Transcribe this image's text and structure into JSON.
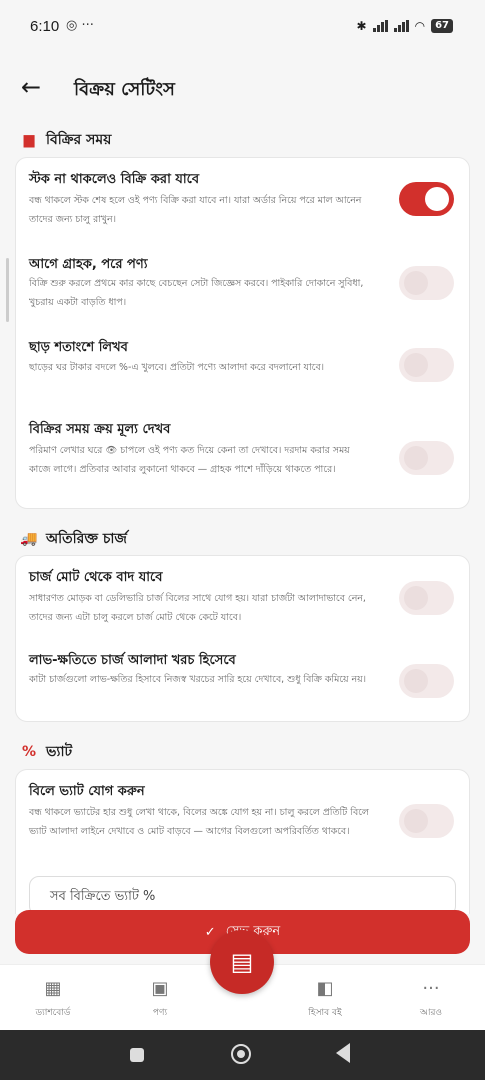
{
  "status": {
    "time": "6:10",
    "left_icons": "◎ ···",
    "battery": "67"
  },
  "appbar": {
    "back_glyph": "←",
    "title": "বিক্রয় সেটিংস"
  },
  "sections": {
    "sales": {
      "icon": "cash-register-icon",
      "icon_glyph": "▆",
      "title": "বিক্রির সময়",
      "rows": [
        {
          "title": "স্টক না থাকলেও বিক্রি করা যাবে",
          "desc": "বন্ধ থাকলে স্টক শেষ হলে ওই পণ্য বিক্রি করা যাবে না। যারা অর্ডার নিয়ে পরে মাল আনেন তাদের জন্য চালু রাখুন।",
          "enabled": true
        },
        {
          "title": "আগে গ্রাহক, পরে পণ্য",
          "desc": "বিক্রি শুরু করলে প্রথমে কার কাছে বেচছেন সেটা জিজ্ঞেস করবে। পাইকারি দোকানে সুবিধা, খুচরায় একটা বাড়তি ধাপ।",
          "enabled": false
        },
        {
          "title": "ছাড় শতাংশে লিখব",
          "desc": "ছাড়ের ঘর টাকার বদলে %-এ খুলবে। প্রতিটা পণ্যে আলাদা করে বদলানো যাবে।",
          "enabled": false
        },
        {
          "title": "বিক্রির সময় ক্রয় মূল্য দেখব",
          "desc": "পরিমাণ লেখার ঘরে 👁 চাপলে ওই পণ্য কত দিয়ে কেনা তা দেখাবে। দরদাম করার সময় কাজে লাগে। প্রতিবার আবার লুকানো থাকবে — গ্রাহক পাশে দাঁড়িয়ে থাকতে পারে।",
          "enabled": false
        }
      ]
    },
    "charges": {
      "icon": "truck-icon",
      "icon_glyph": "🚚",
      "title": "অতিরিক্ত চার্জ",
      "rows": [
        {
          "title": "চার্জ মোট থেকে বাদ যাবে",
          "desc": "সাধারণত মোড়ক বা ডেলিভারি চার্জ বিলের সাথে যোগ হয়। যারা চার্জটা আলাদাভাবে নেন, তাদের জন্য এটা চালু করলে চার্জ মোট থেকে কেটে যাবে।",
          "enabled": false
        },
        {
          "title": "লাভ-ক্ষতিতে চার্জ আলাদা খরচ হিসেবে",
          "desc": "কাটা চার্জগুলো লাভ-ক্ষতির হিসাবে নিজস্ব খরচের সারি হয়ে দেখাবে, শুধু বিক্রি কমিয়ে নয়।",
          "enabled": false
        }
      ]
    },
    "vat": {
      "icon": "percent-icon",
      "icon_glyph": "%",
      "title": "ভ্যাট",
      "rows": [
        {
          "title": "বিলে ভ্যাট যোগ করুন",
          "desc": "বন্ধ থাকলে ভ্যাটের হার শুধু লেখা থাকে, বিলের অঙ্কে যোগ হয় না। চালু করলে প্রতিটি বিলে ভ্যাট আলাদা লাইনে দেখাবে ও মোট বাড়বে — আগের বিলগুলো অপরিবর্তিত থাকবে।",
          "enabled": false
        }
      ],
      "input_label": "সব বিক্রিতে ভ্যাট %"
    }
  },
  "save_button": {
    "check": "✓",
    "label": "সেভ করুন"
  },
  "fab": {
    "icon": "cash-register-icon",
    "glyph": "▤"
  },
  "bottom_nav": [
    {
      "icon": "dashboard-icon",
      "glyph": "▦",
      "label": "ড্যাশবোর্ড"
    },
    {
      "icon": "archive-box-icon",
      "glyph": "▣",
      "label": "পণ্য"
    },
    {
      "icon": "ledger-book-icon",
      "glyph": "◧",
      "label": "হিসাব বই"
    },
    {
      "icon": "more-dots-icon",
      "glyph": "···",
      "label": "আরও"
    }
  ],
  "colors": {
    "accent": "#d2302c",
    "toggle_off": "#f3e9e9",
    "background": "#f6f6f6"
  }
}
